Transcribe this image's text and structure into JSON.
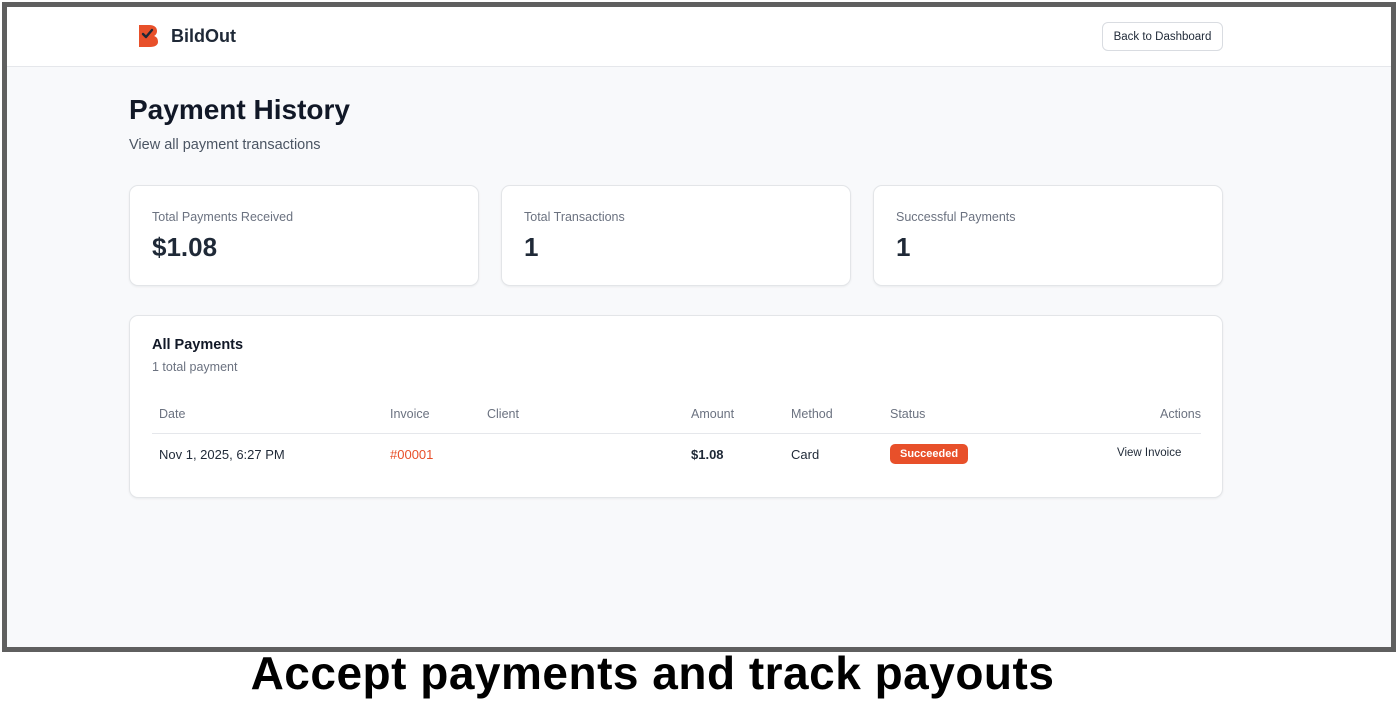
{
  "header": {
    "brand_name": "BildOut",
    "back_button_label": "Back to Dashboard"
  },
  "page": {
    "title": "Payment History",
    "subtitle": "View all payment transactions"
  },
  "stats": [
    {
      "label": "Total Payments Received",
      "value": "$1.08"
    },
    {
      "label": "Total Transactions",
      "value": "1"
    },
    {
      "label": "Successful Payments",
      "value": "1"
    }
  ],
  "payments": {
    "title": "All Payments",
    "count_label": "1 total payment",
    "columns": [
      "Date",
      "Invoice",
      "Client",
      "Amount",
      "Method",
      "Status",
      "Actions"
    ],
    "rows": [
      {
        "date": "Nov 1, 2025, 6:27 PM",
        "invoice": "#00001",
        "client": "",
        "amount": "$1.08",
        "method": "Card",
        "status": "Succeeded",
        "action": "View Invoice"
      }
    ]
  },
  "caption": "Accept payments and track payouts",
  "colors": {
    "accent": "#e8502a",
    "background": "#f8f9fb",
    "text": "#111827"
  },
  "icons": {
    "brand_logo": "bildout-logo-icon"
  }
}
